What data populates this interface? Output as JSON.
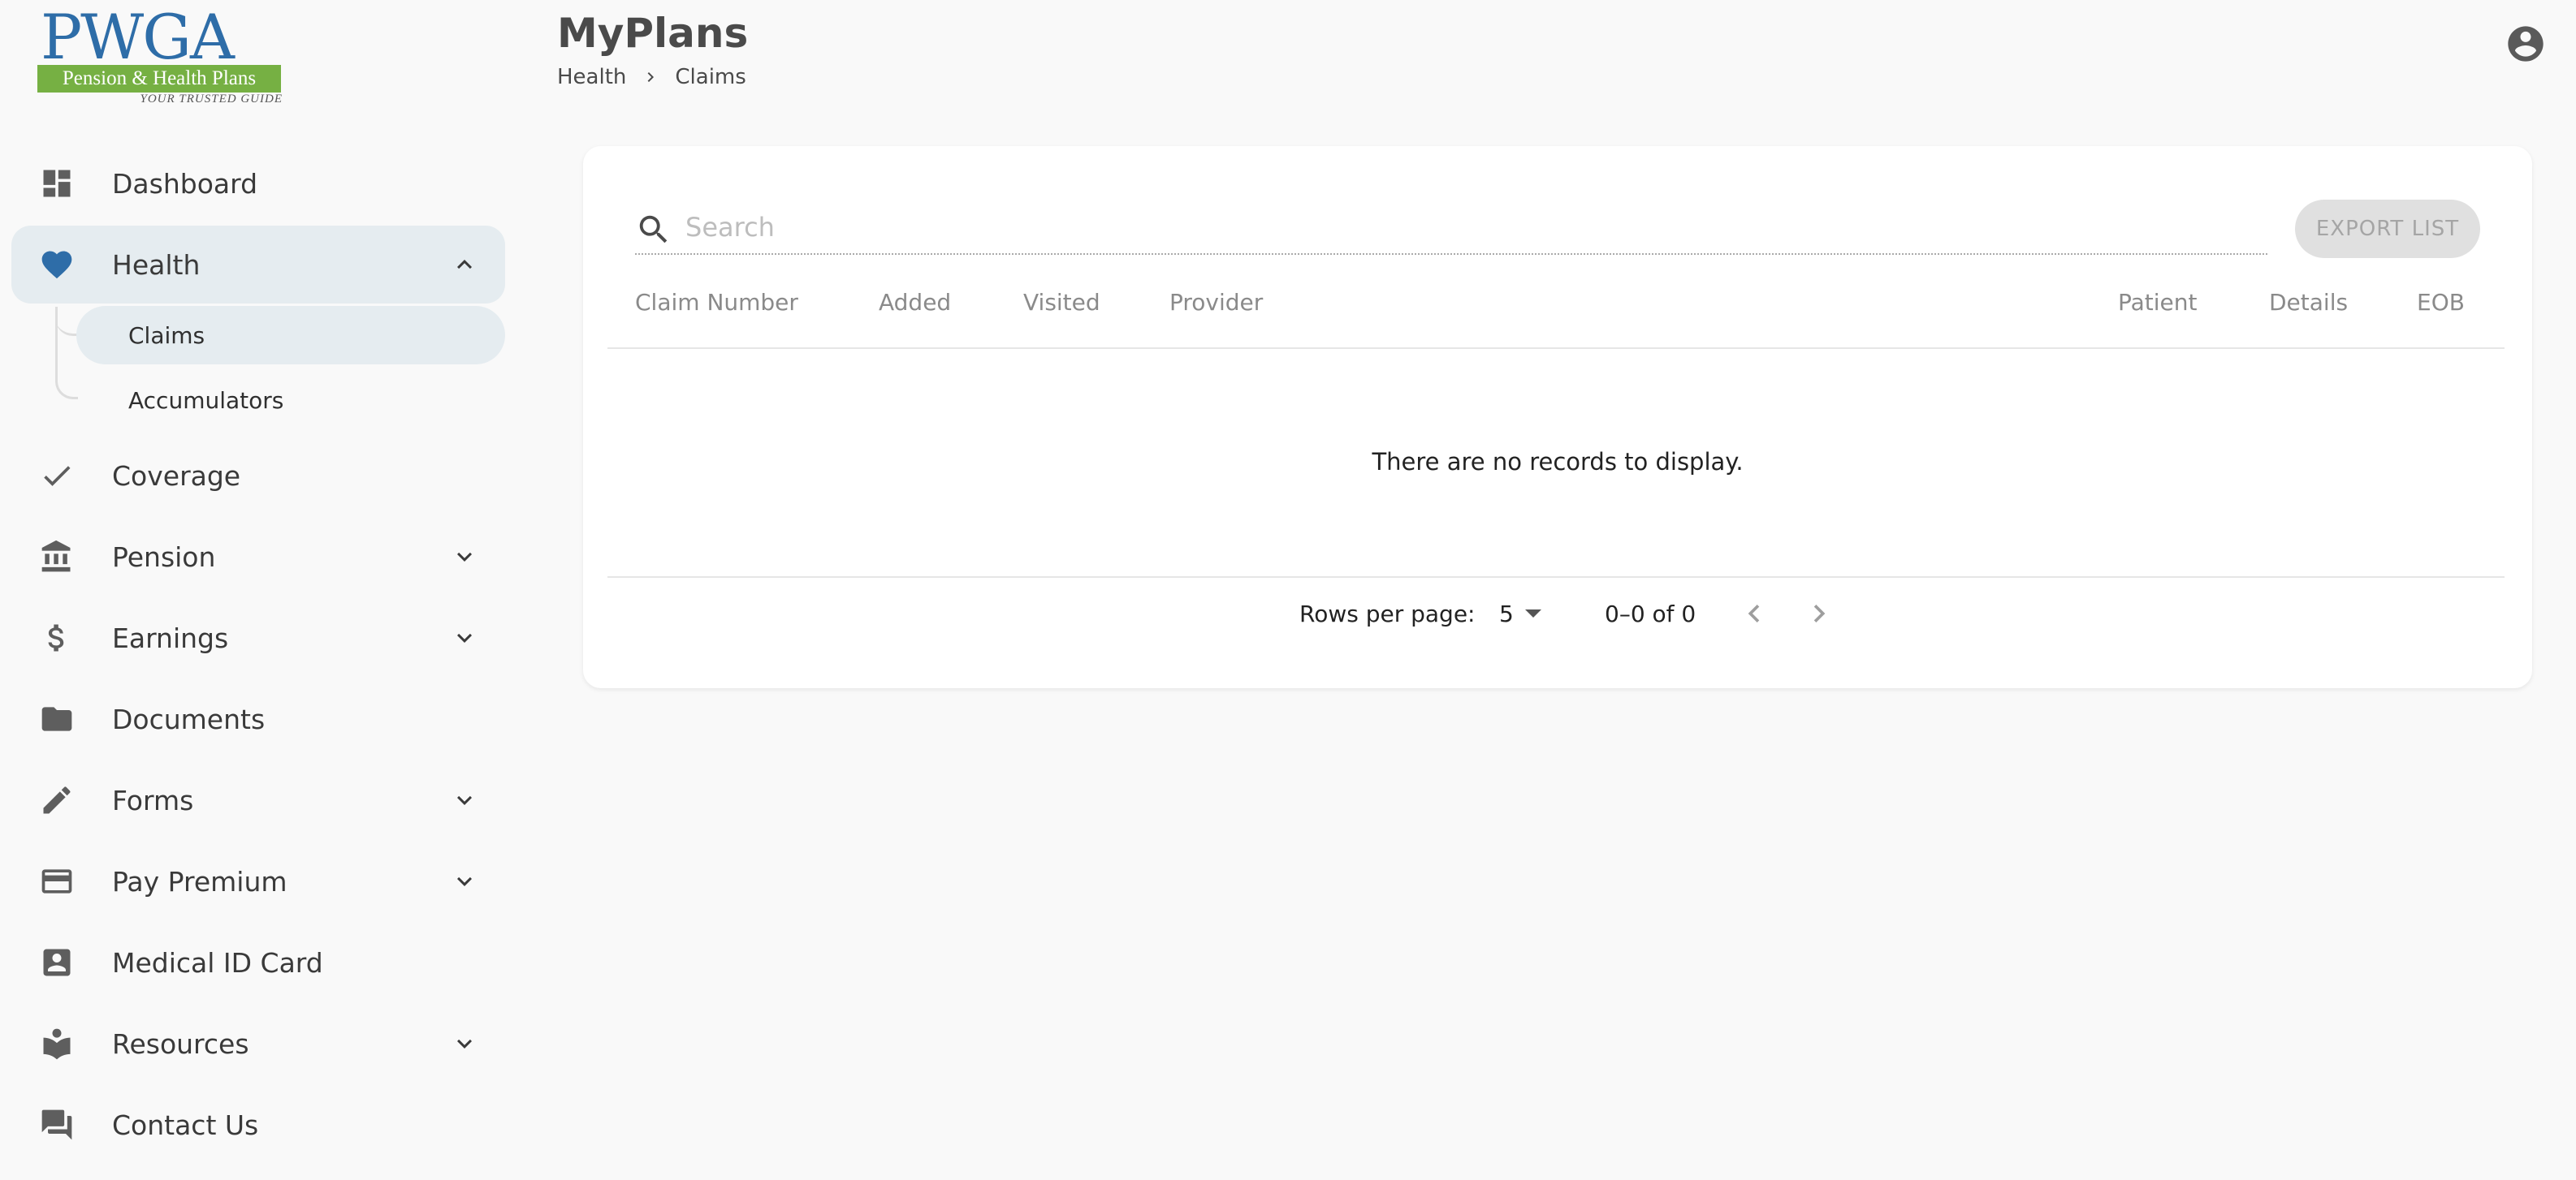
{
  "logo": {
    "wordmark": "PWGA",
    "band_text": "Pension & Health Plans",
    "tagline": "YOUR TRUSTED GUIDE",
    "primary_color": "#2e6da8",
    "band_color": "#76b043"
  },
  "sidebar": {
    "items": [
      {
        "label": "Dashboard",
        "icon": "dashboard-icon"
      },
      {
        "label": "Health",
        "icon": "heart-icon",
        "active": true,
        "expanded": true,
        "icon_color": "#2e6da8"
      },
      {
        "label": "Coverage",
        "icon": "check-icon"
      },
      {
        "label": "Pension",
        "icon": "bank-icon",
        "has_submenu": true
      },
      {
        "label": "Earnings",
        "icon": "dollar-icon",
        "has_submenu": true
      },
      {
        "label": "Documents",
        "icon": "folder-icon"
      },
      {
        "label": "Forms",
        "icon": "pencil-icon",
        "has_submenu": true
      },
      {
        "label": "Pay Premium",
        "icon": "credit-card-icon",
        "has_submenu": true
      },
      {
        "label": "Medical ID Card",
        "icon": "id-card-icon"
      },
      {
        "label": "Resources",
        "icon": "reader-icon",
        "has_submenu": true
      },
      {
        "label": "Contact Us",
        "icon": "chat-icon"
      }
    ],
    "health_sub": [
      {
        "label": "Claims",
        "active": true
      },
      {
        "label": "Accumulators"
      }
    ]
  },
  "header": {
    "title": "MyPlans",
    "breadcrumb": [
      "Health",
      "Claims"
    ]
  },
  "claims": {
    "search_placeholder": "Search",
    "export_label": "EXPORT LIST",
    "columns": [
      "Claim Number",
      "Added",
      "Visited",
      "Provider",
      "Patient",
      "Details",
      "EOB"
    ],
    "empty_message": "There are no records to display.",
    "rows_per_page_label": "Rows per page:",
    "rows_per_page": "5",
    "range": "0–0 of 0"
  }
}
